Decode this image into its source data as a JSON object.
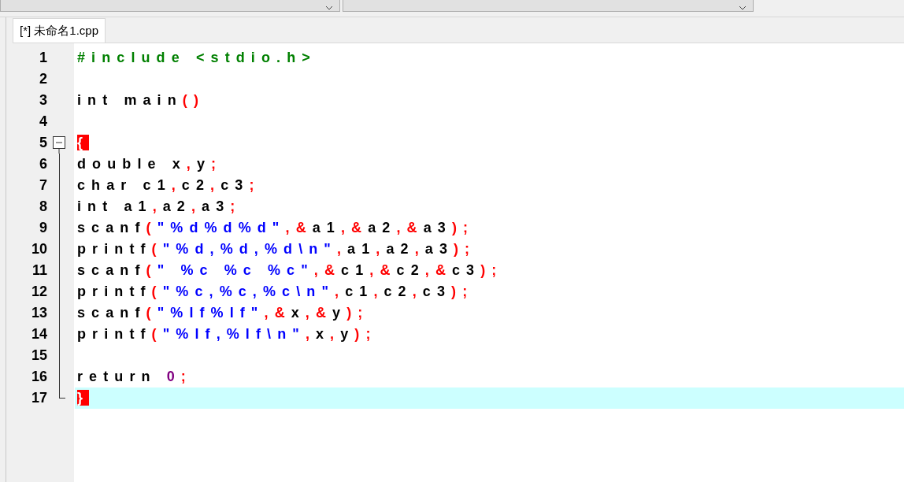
{
  "toolbar": {
    "dropdowns": [
      {
        "kind": "dropdown"
      },
      {
        "kind": "dropdown"
      }
    ]
  },
  "tabs": [
    {
      "label": "[*] 未命名1.cpp",
      "selected": true
    }
  ],
  "editor": {
    "lines": [
      {
        "number": "1",
        "fold_start": false,
        "fold_end": false,
        "current": false,
        "tokens": [
          {
            "text": "#include <stdio.h>",
            "kind": "preprocessor"
          }
        ]
      },
      {
        "number": "2",
        "fold_start": false,
        "fold_end": false,
        "current": false
      },
      {
        "number": "3",
        "fold_start": false,
        "fold_end": false,
        "current": false,
        "tokens": [
          {
            "text": "int main",
            "kind": "plain"
          },
          {
            "text": "()",
            "kind": "symbol"
          }
        ]
      },
      {
        "number": "4",
        "fold_start": false,
        "fold_end": false,
        "current": false
      },
      {
        "number": "5",
        "fold_start": true,
        "fold_end": false,
        "current": false,
        "tokens": [
          {
            "text": "{",
            "kind": "match"
          }
        ]
      },
      {
        "number": "6",
        "fold_start": false,
        "fold_end": false,
        "current": false,
        "tokens": [
          {
            "text": "double x",
            "kind": "plain"
          },
          {
            "text": ",",
            "kind": "symbol"
          },
          {
            "text": "y",
            "kind": "plain"
          },
          {
            "text": ";",
            "kind": "symbol"
          }
        ]
      },
      {
        "number": "7",
        "fold_start": false,
        "fold_end": false,
        "current": false,
        "tokens": [
          {
            "text": "char c1",
            "kind": "plain"
          },
          {
            "text": ",",
            "kind": "symbol"
          },
          {
            "text": "c2",
            "kind": "plain"
          },
          {
            "text": ",",
            "kind": "symbol"
          },
          {
            "text": "c3",
            "kind": "plain"
          },
          {
            "text": ";",
            "kind": "symbol"
          }
        ]
      },
      {
        "number": "8",
        "fold_start": false,
        "fold_end": false,
        "current": false,
        "tokens": [
          {
            "text": "int a1",
            "kind": "plain"
          },
          {
            "text": ",",
            "kind": "symbol"
          },
          {
            "text": "a2",
            "kind": "plain"
          },
          {
            "text": ",",
            "kind": "symbol"
          },
          {
            "text": "a3",
            "kind": "plain"
          },
          {
            "text": ";",
            "kind": "symbol"
          }
        ]
      },
      {
        "number": "9",
        "fold_start": false,
        "fold_end": false,
        "current": false,
        "tokens": [
          {
            "text": "scanf",
            "kind": "plain"
          },
          {
            "text": "(",
            "kind": "symbol"
          },
          {
            "text": "\"%d%d%d\"",
            "kind": "string"
          },
          {
            "text": ",",
            "kind": "symbol"
          },
          {
            "text": "&",
            "kind": "symbol"
          },
          {
            "text": "a1",
            "kind": "plain"
          },
          {
            "text": ",",
            "kind": "symbol"
          },
          {
            "text": "&",
            "kind": "symbol"
          },
          {
            "text": "a2",
            "kind": "plain"
          },
          {
            "text": ",",
            "kind": "symbol"
          },
          {
            "text": "&",
            "kind": "symbol"
          },
          {
            "text": "a3",
            "kind": "plain"
          },
          {
            "text": ");",
            "kind": "symbol"
          }
        ]
      },
      {
        "number": "10",
        "fold_start": false,
        "fold_end": false,
        "current": false,
        "tokens": [
          {
            "text": "printf",
            "kind": "plain"
          },
          {
            "text": "(",
            "kind": "symbol"
          },
          {
            "text": "\"%d,%d,%d\\n\"",
            "kind": "string"
          },
          {
            "text": ",",
            "kind": "symbol"
          },
          {
            "text": "a1",
            "kind": "plain"
          },
          {
            "text": ",",
            "kind": "symbol"
          },
          {
            "text": "a2",
            "kind": "plain"
          },
          {
            "text": ",",
            "kind": "symbol"
          },
          {
            "text": "a3",
            "kind": "plain"
          },
          {
            "text": ");",
            "kind": "symbol"
          }
        ]
      },
      {
        "number": "11",
        "fold_start": false,
        "fold_end": false,
        "current": false,
        "tokens": [
          {
            "text": "scanf",
            "kind": "plain"
          },
          {
            "text": "(",
            "kind": "symbol"
          },
          {
            "text": "\" %c %c %c\"",
            "kind": "string"
          },
          {
            "text": ",",
            "kind": "symbol"
          },
          {
            "text": "&",
            "kind": "symbol"
          },
          {
            "text": "c1",
            "kind": "plain"
          },
          {
            "text": ",",
            "kind": "symbol"
          },
          {
            "text": "&",
            "kind": "symbol"
          },
          {
            "text": "c2",
            "kind": "plain"
          },
          {
            "text": ",",
            "kind": "symbol"
          },
          {
            "text": "&",
            "kind": "symbol"
          },
          {
            "text": "c3",
            "kind": "plain"
          },
          {
            "text": ");",
            "kind": "symbol"
          }
        ]
      },
      {
        "number": "12",
        "fold_start": false,
        "fold_end": false,
        "current": false,
        "tokens": [
          {
            "text": "printf",
            "kind": "plain"
          },
          {
            "text": "(",
            "kind": "symbol"
          },
          {
            "text": "\"%c,%c,%c\\n\"",
            "kind": "string"
          },
          {
            "text": ",",
            "kind": "symbol"
          },
          {
            "text": "c1",
            "kind": "plain"
          },
          {
            "text": ",",
            "kind": "symbol"
          },
          {
            "text": "c2",
            "kind": "plain"
          },
          {
            "text": ",",
            "kind": "symbol"
          },
          {
            "text": "c3",
            "kind": "plain"
          },
          {
            "text": ");",
            "kind": "symbol"
          }
        ]
      },
      {
        "number": "13",
        "fold_start": false,
        "fold_end": false,
        "current": false,
        "tokens": [
          {
            "text": "scanf",
            "kind": "plain"
          },
          {
            "text": "(",
            "kind": "symbol"
          },
          {
            "text": "\"%lf%lf\"",
            "kind": "string"
          },
          {
            "text": ",",
            "kind": "symbol"
          },
          {
            "text": "&",
            "kind": "symbol"
          },
          {
            "text": "x",
            "kind": "plain"
          },
          {
            "text": ",",
            "kind": "symbol"
          },
          {
            "text": "&",
            "kind": "symbol"
          },
          {
            "text": "y",
            "kind": "plain"
          },
          {
            "text": ");",
            "kind": "symbol"
          }
        ]
      },
      {
        "number": "14",
        "fold_start": false,
        "fold_end": false,
        "current": false,
        "tokens": [
          {
            "text": "printf",
            "kind": "plain"
          },
          {
            "text": "(",
            "kind": "symbol"
          },
          {
            "text": "\"%lf,%lf\\n\"",
            "kind": "string"
          },
          {
            "text": ",",
            "kind": "symbol"
          },
          {
            "text": "x",
            "kind": "plain"
          },
          {
            "text": ",",
            "kind": "symbol"
          },
          {
            "text": "y",
            "kind": "plain"
          },
          {
            "text": ");",
            "kind": "symbol"
          }
        ]
      },
      {
        "number": "15",
        "fold_start": false,
        "fold_end": false,
        "current": false
      },
      {
        "number": "16",
        "fold_start": false,
        "fold_end": false,
        "current": false,
        "tokens": [
          {
            "text": "return ",
            "kind": "plain"
          },
          {
            "text": "0",
            "kind": "number"
          },
          {
            "text": ";",
            "kind": "symbol"
          }
        ]
      },
      {
        "number": "17",
        "fold_start": false,
        "fold_end": true,
        "current": true,
        "tokens": [
          {
            "text": "}",
            "kind": "match"
          }
        ]
      }
    ]
  }
}
